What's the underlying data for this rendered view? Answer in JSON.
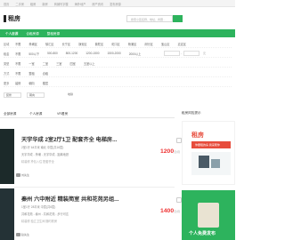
{
  "topbar": {
    "items": [
      "首页",
      "二手房",
      "租房",
      "新房",
      "商铺写字楼",
      "海外地产",
      "房产资讯",
      "发布房源"
    ]
  },
  "header": {
    "title": "租房",
    "search_placeholder": "搜索小区名称、地址、商圈..."
  },
  "greenbar": {
    "tabs": [
      "个人房源",
      "合租房源",
      "整租房源"
    ]
  },
  "filters": {
    "rows": [
      {
        "label": "区域",
        "options": [
          "不限",
          "黄埔区",
          "徐汇区",
          "长宁区",
          "静安区",
          "普陀区",
          "虹口区",
          "杨浦区",
          "闵行区",
          "宝山区",
          "嘉定区"
        ]
      },
      {
        "label": "租金",
        "options": [
          "不限",
          "500以下",
          "500-800",
          "800-1200",
          "1200-1500",
          "1500-2000",
          "2000以上"
        ],
        "range_unit": "元"
      },
      {
        "label": "类型",
        "options": [
          "不限",
          "一室",
          "二室",
          "三室",
          "四室",
          "五室以上"
        ]
      },
      {
        "label": "方式",
        "options": [
          "不限",
          "整租",
          "合租"
        ]
      },
      {
        "label": "更多",
        "options": [
          "装修",
          "朝向",
          "楼层"
        ]
      }
    ],
    "selects": [
      "装修",
      "朝向",
      "地铁"
    ]
  },
  "tabs2": [
    "全部房源",
    "个人房源",
    "VR看房"
  ],
  "side_title": "租房风险提示",
  "listings": [
    {
      "title": "天宇华成 2室2厅1卫 配套齐全 电梯房...",
      "info": "2室1厅  64平米  南北  中层(共16层)",
      "addr": "天宇华成 - 黄埔 - 天宇华成 - 距离地铁",
      "addr2": "精装修  拎包入住  配套齐全",
      "price": "1200",
      "unit": "元/月",
      "agent": "刘先生"
    },
    {
      "title": "秦州 六中附近 精装简室 共和花苑另组...",
      "info": "1室1厅  28平米  中层(共6层)",
      "addr": "共和花苑 - 秦州 - 共和花苑 - 步行可达",
      "addr2": "精装修  独立卫生间  随时看房",
      "price": "1400",
      "unit": "元/月",
      "agent": "赵先生"
    }
  ],
  "ads": {
    "red_text": "租房",
    "sub_text": "你要租的房 我来帮你",
    "green_text": "个人免费发布"
  }
}
